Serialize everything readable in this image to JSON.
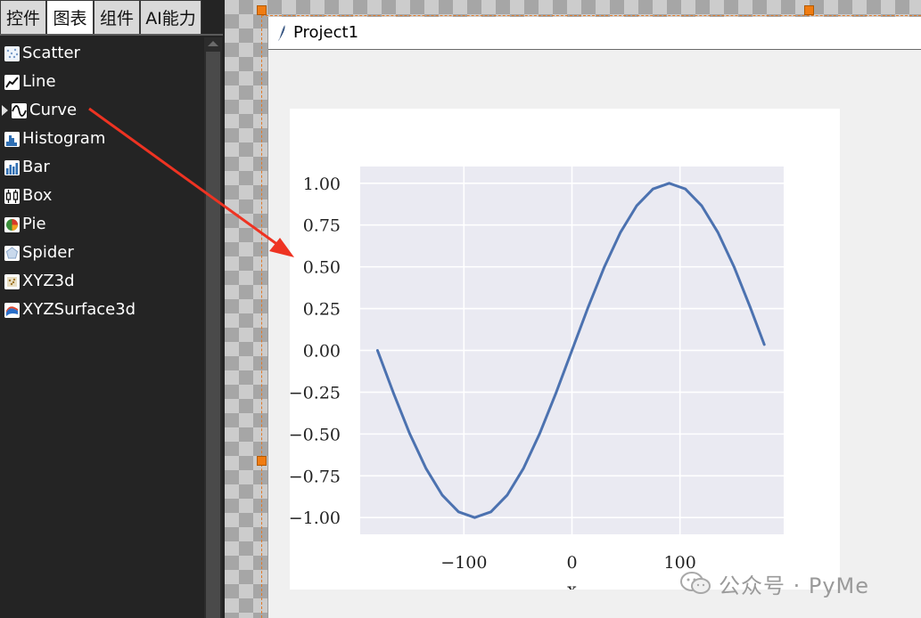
{
  "sidebar": {
    "tabs": [
      {
        "label": "控件"
      },
      {
        "label": "图表"
      },
      {
        "label": "组件"
      },
      {
        "label": "AI能力"
      }
    ],
    "items": [
      {
        "label": "Scatter",
        "icon": "scatter-icon"
      },
      {
        "label": "Line",
        "icon": "line-icon"
      },
      {
        "label": "Curve",
        "icon": "curve-icon"
      },
      {
        "label": "Histogram",
        "icon": "histogram-icon"
      },
      {
        "label": "Bar",
        "icon": "bar-icon"
      },
      {
        "label": "Box",
        "icon": "box-icon"
      },
      {
        "label": "Pie",
        "icon": "pie-icon"
      },
      {
        "label": "Spider",
        "icon": "spider-icon"
      },
      {
        "label": "XYZ3d",
        "icon": "xyz3d-icon"
      },
      {
        "label": "XYZSurface3d",
        "icon": "surface3d-icon"
      }
    ]
  },
  "window": {
    "title": "Project1"
  },
  "chart_data": {
    "type": "line",
    "x": [
      -180,
      -165,
      -150,
      -135,
      -120,
      -105,
      -90,
      -75,
      -60,
      -45,
      -30,
      -15,
      0,
      15,
      30,
      45,
      60,
      75,
      90,
      105,
      120,
      135,
      150,
      165,
      178
    ],
    "series": [
      {
        "values": [
          0.0,
          -0.259,
          -0.5,
          -0.707,
          -0.866,
          -0.966,
          -1.0,
          -0.966,
          -0.866,
          -0.707,
          -0.5,
          -0.259,
          0.0,
          0.259,
          0.5,
          0.707,
          0.866,
          0.966,
          1.0,
          0.966,
          0.866,
          0.707,
          0.5,
          0.259,
          0.035
        ],
        "color": "#4c72b0"
      }
    ],
    "xticks": [
      "−100",
      "0",
      "100"
    ],
    "yticks": [
      "1.00",
      "0.75",
      "0.50",
      "0.25",
      "0.00",
      "−0.25",
      "−0.50",
      "−0.75",
      "−1.00"
    ],
    "xlabel": "x",
    "ylabel": "",
    "xlim": [
      -196,
      196
    ],
    "ylim": [
      -1.1,
      1.1
    ],
    "grid": true,
    "background": "#eaeaf2"
  },
  "watermark": {
    "text": "公众号 · PyMe"
  },
  "colors": {
    "accent_arrow": "#ee3322",
    "handle": "#f07c12"
  }
}
